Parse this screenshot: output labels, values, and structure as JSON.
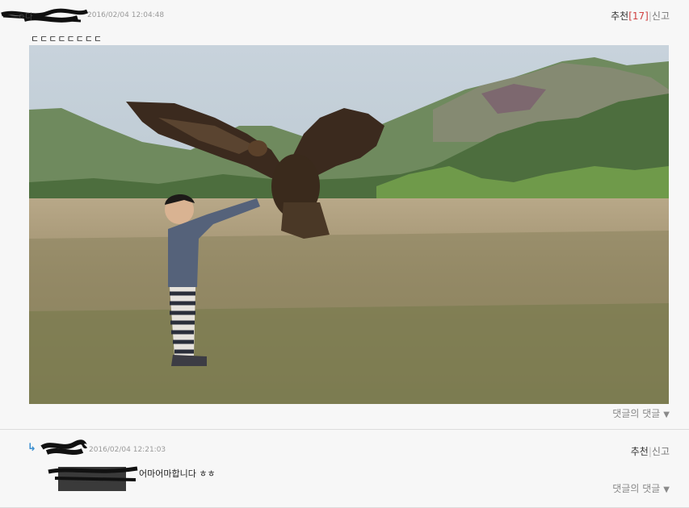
{
  "comment1": {
    "author_visible": "ㅇ다",
    "date": "2016/02/04 12:04:48",
    "text": "ㄷㄷㄷㄷㄷㄷㄷㄷ",
    "recommend_label": "추천",
    "recommend_count": "[17]",
    "separator": "|",
    "report_label": "신고",
    "reply_label": "댓글의 댓글",
    "reply_icon": "triangle-down-icon"
  },
  "comment2": {
    "arrow_icon": "reply-arrow-icon",
    "date": "2016/02/04 12:21:03",
    "text": "어마어마합니다 ㅎㅎ",
    "recommend_label": "추천",
    "separator": "|",
    "report_label": "신고",
    "reply_label": "댓글의 댓글",
    "reply_icon": "triangle-down-icon"
  },
  "colors": {
    "background": "#f7f7f7",
    "recommend_count": "#d04040",
    "reply_arrow": "#3b8fd0",
    "divider": "#dcdcdc"
  }
}
